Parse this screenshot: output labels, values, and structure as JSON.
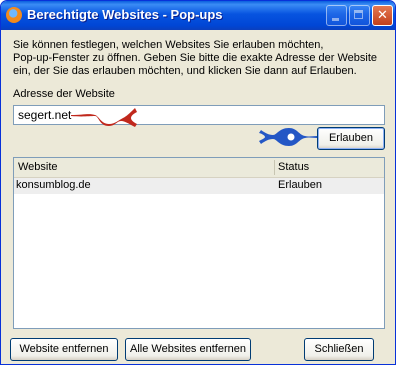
{
  "window": {
    "title": "Berechtigte Websites - Pop-ups"
  },
  "description": {
    "line1": "Sie können festlegen, welchen Websites Sie erlauben möchten,",
    "line2": "Pop-up-Fenster zu öffnen. Geben Sie bitte die exakte Adresse der Website",
    "line3": "ein, der Sie das erlauben möchten, und klicken Sie dann auf Erlauben."
  },
  "address": {
    "label": "Adresse der Website",
    "value": "segert.net"
  },
  "buttons": {
    "allow": "Erlauben",
    "remove_site": "Website entfernen",
    "remove_all": "Alle Websites entfernen",
    "close": "Schließen"
  },
  "table": {
    "columns": [
      "Website",
      "Status"
    ],
    "rows": [
      {
        "website": "konsumblog.de",
        "status": "Erlauben"
      }
    ]
  },
  "annotations": {
    "input_marker_color": "#c0281c",
    "button_marker_color": "#2457c5"
  }
}
